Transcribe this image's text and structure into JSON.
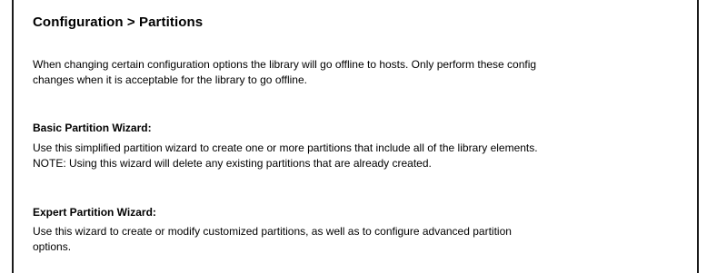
{
  "page": {
    "title": "Configuration > Partitions",
    "intro_lines": [
      "When changing certain configuration options the library will go offline to hosts. Only perform these config",
      "changes when it is acceptable for the library to go offline."
    ]
  },
  "basic_wizard": {
    "heading": "Basic Partition Wizard:",
    "description_lines": [
      "Use this simplified partition wizard to create one or more partitions that include all of the library elements.",
      "NOTE: Using this wizard will delete any existing partitions that are already created."
    ]
  },
  "expert_wizard": {
    "heading": "Expert Partition Wizard:",
    "description_lines": [
      "Use this wizard to create or modify customized partitions, as well as to configure advanced partition",
      "options."
    ]
  }
}
